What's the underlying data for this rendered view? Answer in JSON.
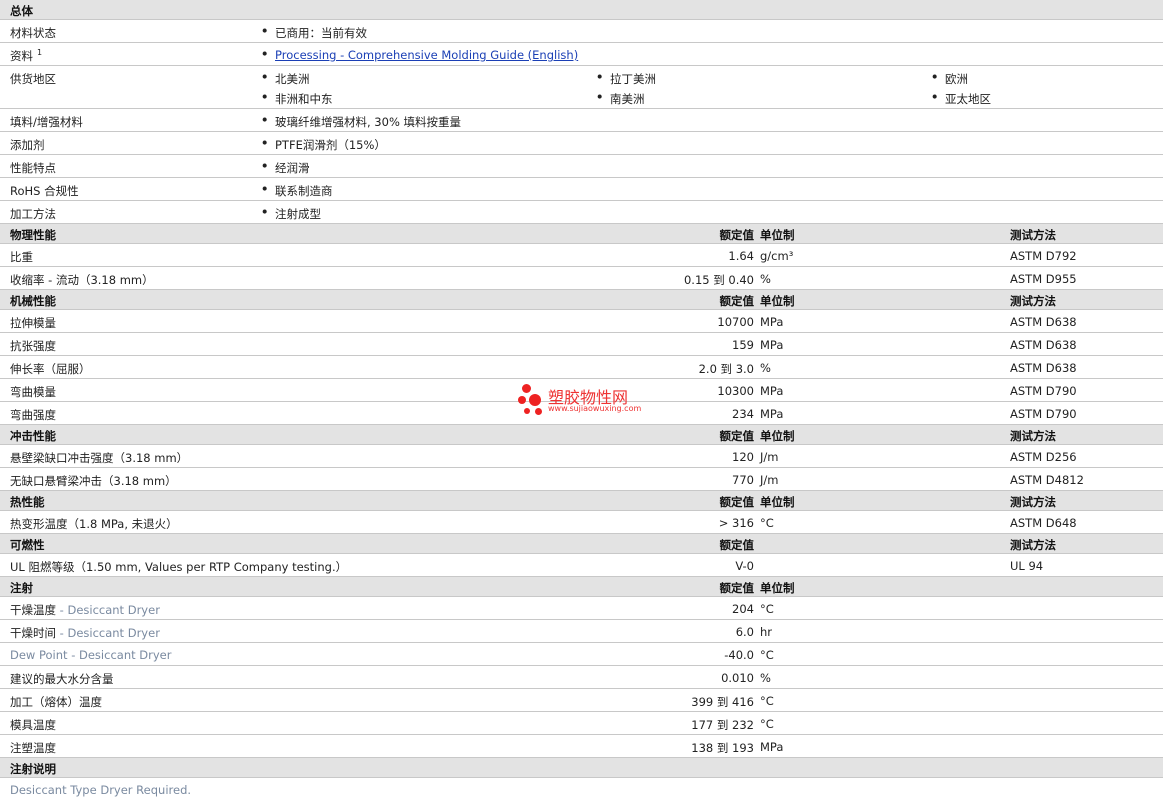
{
  "general": {
    "title": "总体",
    "rows": [
      {
        "label": "材料状态",
        "items": [
          "已商用：当前有效"
        ]
      },
      {
        "label": "资料",
        "sup": "1",
        "link": "Processing - Comprehensive Molding Guide (English)"
      },
      {
        "label": "供货地区",
        "regions": [
          "北美洲",
          "拉丁美洲",
          "欧洲",
          "非洲和中东",
          "南美洲",
          "亚太地区"
        ]
      },
      {
        "label": "填料/增强材料",
        "items": [
          "玻璃纤维增强材料, 30% 填料按重量"
        ]
      },
      {
        "label": "添加剂",
        "items": [
          "PTFE润滑剂（15%）"
        ]
      },
      {
        "label": "性能特点",
        "items": [
          "经润滑"
        ]
      },
      {
        "label": "RoHS 合规性",
        "items": [
          "联系制造商"
        ]
      },
      {
        "label": "加工方法",
        "items": [
          "注射成型"
        ]
      }
    ]
  },
  "columns": {
    "nominal": "额定值",
    "unit": "单位制",
    "test": "测试方法"
  },
  "sections": [
    {
      "title": "物理性能",
      "show_unit": true,
      "show_test": true,
      "rows": [
        {
          "name": "比重",
          "value": "1.64",
          "unit": "g/cm³",
          "test": "ASTM D792"
        },
        {
          "name": "收缩率  - 流动（3.18 mm）",
          "value": "0.15 到  0.40",
          "unit": "%",
          "test": "ASTM D955"
        }
      ]
    },
    {
      "title": "机械性能",
      "show_unit": true,
      "show_test": true,
      "rows": [
        {
          "name": "拉伸模量",
          "value": "10700",
          "unit": "MPa",
          "test": "ASTM D638"
        },
        {
          "name": "抗张强度",
          "value": "159",
          "unit": "MPa",
          "test": "ASTM D638"
        },
        {
          "name": "伸长率（屈服）",
          "value": "2.0 到  3.0",
          "unit": "%",
          "test": "ASTM D638"
        },
        {
          "name": "弯曲模量",
          "value": "10300",
          "unit": "MPa",
          "test": "ASTM D790"
        },
        {
          "name": "弯曲强度",
          "value": "234",
          "unit": "MPa",
          "test": "ASTM D790"
        }
      ]
    },
    {
      "title": "冲击性能",
      "show_unit": true,
      "show_test": true,
      "rows": [
        {
          "name": "悬壁梁缺口冲击强度（3.18 mm）",
          "value": "120",
          "unit": "J/m",
          "test": "ASTM D256"
        },
        {
          "name": "无缺口悬臂梁冲击（3.18 mm）",
          "value": "770",
          "unit": "J/m",
          "test": "ASTM D4812"
        }
      ]
    },
    {
      "title": "热性能",
      "show_unit": true,
      "show_test": true,
      "rows": [
        {
          "name": "热变形温度（1.8 MPa, 未退火）",
          "value": "> 316",
          "unit": "°C",
          "test": "ASTM D648"
        }
      ]
    },
    {
      "title": "可燃性",
      "show_unit": false,
      "show_test": true,
      "rows": [
        {
          "name": "UL 阻燃等级（1.50 mm, Values per RTP Company testing.）",
          "value": "V-0",
          "unit": "",
          "test": "UL 94"
        }
      ]
    },
    {
      "title": "注射",
      "show_unit": true,
      "show_test": false,
      "rows": [
        {
          "name": "干燥温度",
          "method": " - Desiccant Dryer",
          "value": "204",
          "unit": "°C",
          "test": ""
        },
        {
          "name": "干燥时间",
          "method": " - Desiccant Dryer",
          "value": "6.0",
          "unit": "hr",
          "test": ""
        },
        {
          "name": "",
          "method": "Dew Point - Desiccant Dryer",
          "value": "-40.0",
          "unit": "°C",
          "test": ""
        },
        {
          "name": "建议的最大水分含量",
          "value": "0.010",
          "unit": "%",
          "test": ""
        },
        {
          "name": "加工（熔体）温度",
          "value": "399 到  416",
          "unit": "°C",
          "test": ""
        },
        {
          "name": "模具温度",
          "value": "177 到  232",
          "unit": "°C",
          "test": ""
        },
        {
          "name": "注塑温度",
          "value": "138 到  193",
          "unit": "MPa",
          "test": ""
        }
      ]
    }
  ],
  "notes": {
    "title": "注射说明",
    "text": "Desiccant Type Dryer Required."
  },
  "watermark": {
    "name": "塑胶物性网",
    "url": "www.sujiaowuxing.com",
    "color": "#e33333"
  }
}
